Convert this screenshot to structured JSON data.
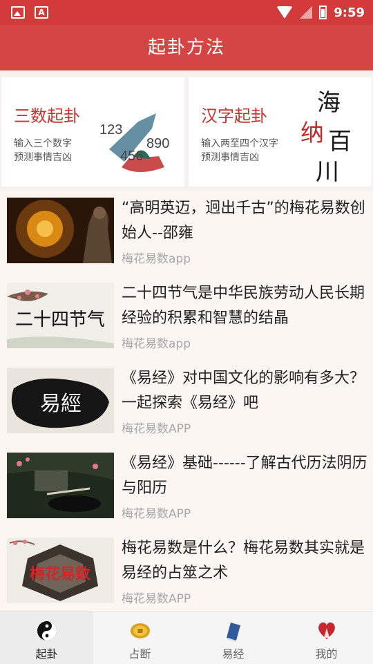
{
  "status_bar": {
    "time": "9:59"
  },
  "header": {
    "title": "起卦方法"
  },
  "cards": [
    {
      "title": "三数起卦",
      "desc1": "输入三个数字",
      "desc2": "预测事情吉凶",
      "art_text": [
        "123",
        "890",
        "456"
      ]
    },
    {
      "title": "汉字起卦",
      "desc1": "输入两至四个汉字",
      "desc2": "预测事情吉凶",
      "art_text": "海纳百川"
    }
  ],
  "news": [
    {
      "title": "“高明英迈，迥出千古”的梅花易数创始人--邵雍",
      "source": "梅花易数app"
    },
    {
      "title": "二十四节气是中华民族劳动人民长期经验的积累和智慧的结晶",
      "source": "梅花易数app",
      "thumb_text": "二十四节气"
    },
    {
      "title": "《易经》对中国文化的影响有多大？一起探索《易经》吧",
      "source": "梅花易数APP",
      "thumb_text": "易經"
    },
    {
      "title": "《易经》基础------了解古代历法阴历与阳历",
      "source": "梅花易数APP"
    },
    {
      "title": "梅花易数是什么？梅花易数其实就是易经的占筮之术",
      "source": "梅花易数APP",
      "thumb_text": "梅花易数"
    }
  ],
  "tabs": [
    {
      "label": "起卦",
      "icon": "yin-yang-icon",
      "active": true
    },
    {
      "label": "占断",
      "icon": "coin-icon",
      "active": false
    },
    {
      "label": "易经",
      "icon": "book-icon",
      "active": false
    },
    {
      "label": "我的",
      "icon": "profile-icon",
      "active": false
    }
  ]
}
